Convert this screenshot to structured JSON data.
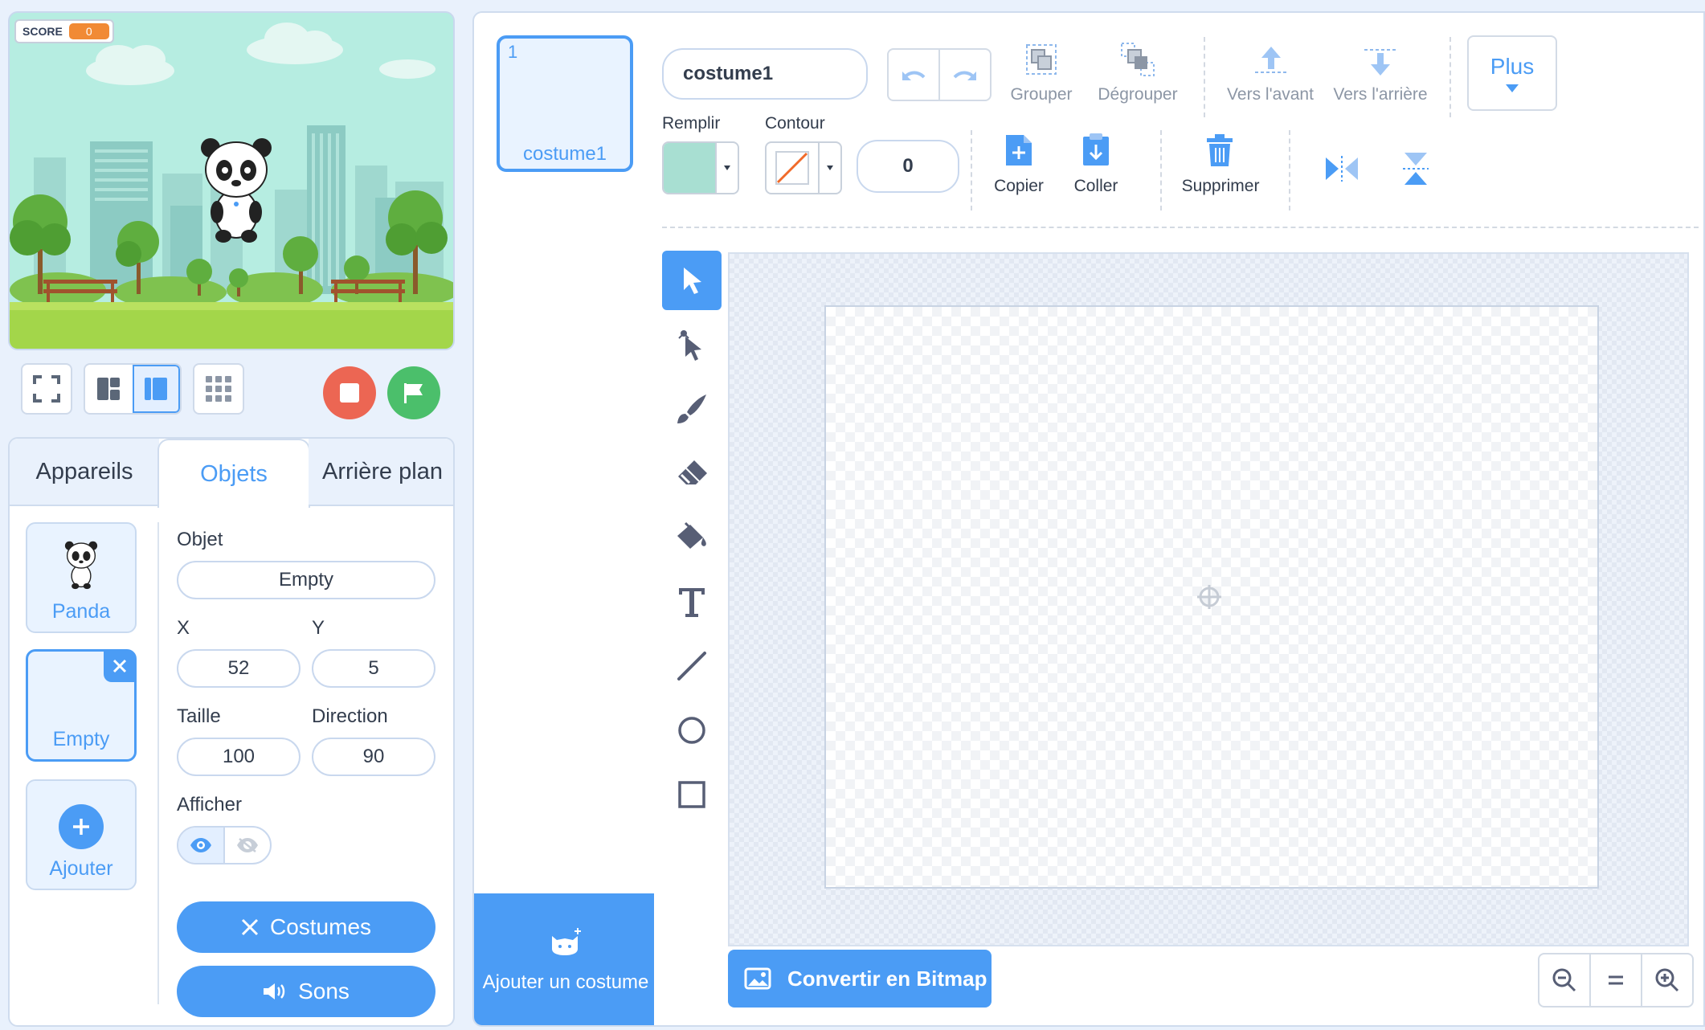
{
  "stage": {
    "score_label": "SCORE",
    "score_value": "0"
  },
  "tabs": [
    {
      "label": "Appareils"
    },
    {
      "label": "Objets"
    },
    {
      "label": "Arrière plan"
    }
  ],
  "sprites": [
    {
      "name": "Panda"
    },
    {
      "name": "Empty"
    }
  ],
  "add_sprite_label": "Ajouter",
  "properties": {
    "object_label": "Objet",
    "object_value": "Empty",
    "x_label": "X",
    "x_value": "52",
    "y_label": "Y",
    "y_value": "5",
    "size_label": "Taille",
    "size_value": "100",
    "direction_label": "Direction",
    "direction_value": "90",
    "show_label": "Afficher"
  },
  "buttons": {
    "costumes": "Costumes",
    "sons": "Sons"
  },
  "costumes": [
    {
      "number": "1",
      "name": "costume1"
    }
  ],
  "add_costume_label": "Ajouter un costume",
  "editor": {
    "costume_name": "costume1",
    "group": "Grouper",
    "ungroup": "Dégrouper",
    "forward": "Vers l'avant",
    "backward": "Vers l'arrière",
    "more": "Plus",
    "fill_label": "Remplir",
    "outline_label": "Contour",
    "outline_width": "0",
    "copy": "Copier",
    "paste": "Coller",
    "delete": "Supprimer",
    "convert": "Convertir en Bitmap",
    "fill_color": "#a8dfd2",
    "accent": "#4b9cf5"
  }
}
